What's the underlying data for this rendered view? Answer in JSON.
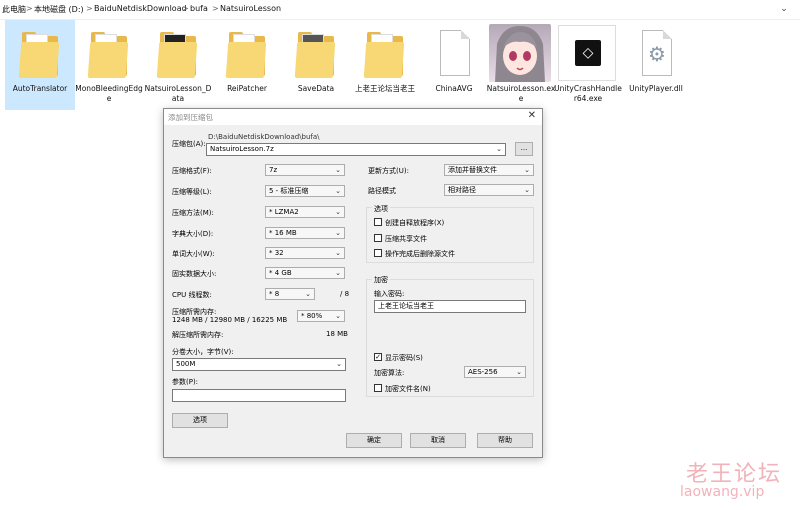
{
  "breadcrumb": {
    "items": [
      "此电脑",
      "本地磁盘 (D:)",
      "BaiduNetdiskDownload",
      "bufa",
      "NatsuiroLesson"
    ],
    "separator": ">",
    "dropdown": "⌄"
  },
  "files": [
    {
      "name": "AutoTranslator",
      "type": "folder"
    },
    {
      "name": "MonoBleedingEdge",
      "type": "folder"
    },
    {
      "name": "NatsuiroLesson_Data",
      "type": "folder"
    },
    {
      "name": "ReiPatcher",
      "type": "folder"
    },
    {
      "name": "SaveData",
      "type": "folder"
    },
    {
      "name": "上老王论坛当老王",
      "type": "folder"
    },
    {
      "name": "ChinaAVG",
      "type": "file"
    },
    {
      "name": "NatsuiroLesson.exe",
      "type": "exe"
    },
    {
      "name": "UnityCrashHandler64.exe",
      "type": "exe"
    },
    {
      "name": "UnityPlayer.dll",
      "type": "dll"
    }
  ],
  "dialog": {
    "title": "添加到压缩包",
    "close": "✕",
    "archive_label": "压缩包(A):",
    "archive_path": "D:\\BaiduNetdiskDownload\\bufa\\",
    "archive_name": "NatsuiroLesson.7z",
    "browse": "...",
    "format_label": "压缩格式(F):",
    "format_value": "7z",
    "level_label": "压缩等级(L):",
    "level_value": "5 - 标准压缩",
    "method_label": "压缩方法(M):",
    "method_value": "* LZMA2",
    "dict_label": "字典大小(D):",
    "dict_value": "* 16 MB",
    "word_label": "单词大小(W):",
    "word_value": "* 32",
    "solid_label": "固实数据大小:",
    "solid_value": "* 4 GB",
    "cpu_label": "CPU 线程数:",
    "cpu_value": "* 8",
    "cpu_total": "/ 8",
    "mem_label": "压缩所需内存:",
    "mem_detail": "1248 MB / 12980 MB / 16225 MB",
    "mem_pct": "* 80%",
    "decomp_label": "解压缩所需内存:",
    "decomp_value": "18 MB",
    "split_label": "分卷大小，字节(V):",
    "split_value": "500M",
    "params_label": "参数(P):",
    "options_button": "选项",
    "update_label": "更新方式(U):",
    "update_value": "添加并替换文件",
    "path_label": "路径模式",
    "path_value": "相对路径",
    "options_group": "选项",
    "opt_sfx": "创建自释放程序(X)",
    "opt_shared": "压缩共享文件",
    "opt_delete": "操作完成后删除源文件",
    "encrypt_group": "加密",
    "password_label": "输入密码:",
    "password_value": "上老王论坛当老王",
    "show_password": "显示密码(S)",
    "enc_method_label": "加密算法:",
    "enc_method_value": "AES-256",
    "enc_names": "加密文件名(N)",
    "ok": "确定",
    "cancel": "取消",
    "help": "帮助"
  },
  "watermark": {
    "line1": "老王论坛",
    "line2": "laowang.vip"
  }
}
